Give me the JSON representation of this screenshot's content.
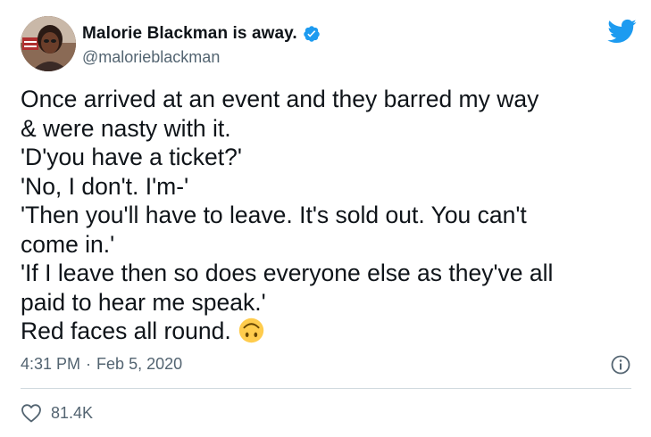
{
  "author": {
    "display_name": "Malorie Blackman is away.",
    "handle": "@malorieblackman",
    "verified": true,
    "avatar_icon": "profile-photo"
  },
  "tweet": {
    "lines": [
      "Once arrived at an event and they barred my way",
      "& were nasty with it.",
      "'D'you have a ticket?'",
      "'No, I don't. I'm-'",
      "'Then you'll have to leave. It's sold out. You can't",
      "come in.'",
      "'If I leave then so does everyone else as they've all",
      "paid to hear me speak.'",
      "Red faces all round."
    ],
    "emoji": "upside-down-face"
  },
  "meta": {
    "time": "4:31 PM",
    "separator": "·",
    "date": "Feb 5, 2020"
  },
  "stats": {
    "likes": "81.4K"
  },
  "colors": {
    "brand": "#1d9bf0",
    "text": "#0f1419",
    "secondary": "#536471",
    "emoji": "#ffcc4d"
  },
  "icons": {
    "logo": "twitter-bird-icon",
    "verified": "verified-badge-icon",
    "info": "info-icon",
    "like": "heart-icon"
  }
}
